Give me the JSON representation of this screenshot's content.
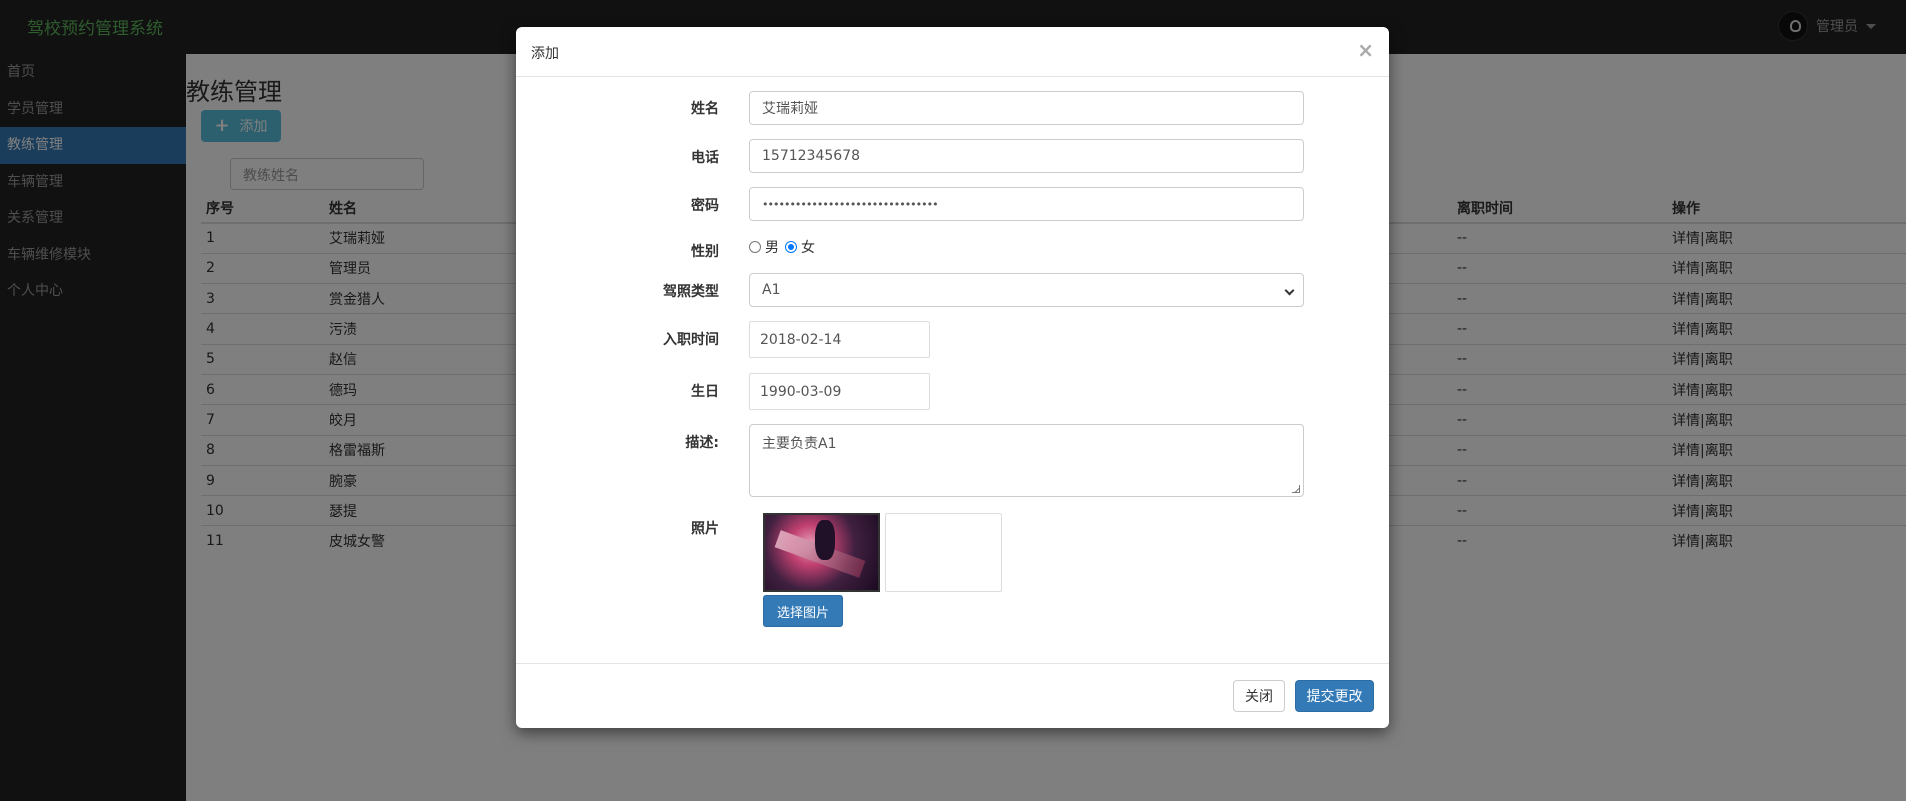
{
  "app": {
    "title": "驾校预约管理系统",
    "user": "管理员"
  },
  "sidebar": {
    "items": [
      {
        "label": "首页"
      },
      {
        "label": "学员管理"
      },
      {
        "label": "教练管理",
        "active": true
      },
      {
        "label": "车辆管理"
      },
      {
        "label": "关系管理"
      },
      {
        "label": "车辆维修模块"
      },
      {
        "label": "个人中心"
      }
    ]
  },
  "main": {
    "title": "教练管理",
    "add_button": "添加",
    "search_placeholder": "教练姓名",
    "table": {
      "headers": {
        "seq": "序号",
        "name": "姓名",
        "leave_time": "离职时间",
        "actions": "操作"
      },
      "rows": [
        {
          "seq": "1",
          "name": "艾瑞莉娅",
          "leave_time": "--",
          "actions": "详情|离职"
        },
        {
          "seq": "2",
          "name": "管理员",
          "leave_time": "--",
          "actions": "详情|离职"
        },
        {
          "seq": "3",
          "name": "赏金猎人",
          "leave_time": "--",
          "actions": "详情|离职"
        },
        {
          "seq": "4",
          "name": "污渍",
          "leave_time": "--",
          "actions": "详情|离职"
        },
        {
          "seq": "5",
          "name": "赵信",
          "leave_time": "--",
          "actions": "详情|离职"
        },
        {
          "seq": "6",
          "name": "德玛",
          "leave_time": "--",
          "actions": "详情|离职"
        },
        {
          "seq": "7",
          "name": "皎月",
          "leave_time": "--",
          "actions": "详情|离职"
        },
        {
          "seq": "8",
          "name": "格雷福斯",
          "leave_time": "--",
          "actions": "详情|离职"
        },
        {
          "seq": "9",
          "name": "腕豪",
          "leave_time": "--",
          "actions": "详情|离职"
        },
        {
          "seq": "10",
          "name": "瑟提",
          "leave_time": "--",
          "actions": "详情|离职"
        },
        {
          "seq": "11",
          "name": "皮城女警",
          "leave_time": "--",
          "actions": "详情|离职"
        }
      ]
    }
  },
  "modal": {
    "title": "添加",
    "close_glyph": "×",
    "fields": {
      "name": {
        "label": "姓名",
        "value": "艾瑞莉娅"
      },
      "phone": {
        "label": "电话",
        "value": "15712345678"
      },
      "password": {
        "label": "密码",
        "value": "••••••••••••••••••••••••••••••••"
      },
      "gender": {
        "label": "性别",
        "options": [
          "男",
          "女"
        ],
        "selected": "女"
      },
      "license": {
        "label": "驾照类型",
        "value": "A1"
      },
      "hire_date": {
        "label": "入职时间",
        "value": "2018-02-14"
      },
      "birthday": {
        "label": "生日",
        "value": "1990-03-09"
      },
      "description": {
        "label": "描述:",
        "value": "主要负责A1"
      },
      "photo": {
        "label": "照片",
        "pick_button": "选择图片"
      }
    },
    "footer": {
      "close_label": "关闭",
      "submit_label": "提交更改"
    }
  }
}
